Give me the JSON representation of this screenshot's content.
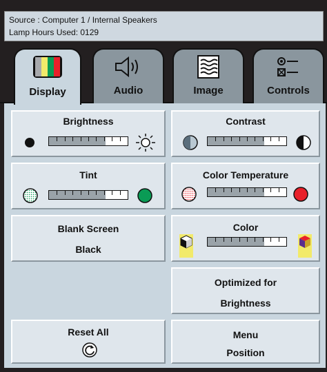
{
  "status": {
    "source_line": "Source : Computer 1 / Internal Speakers",
    "lamp_line": "Lamp Hours Used: 0129"
  },
  "tabs": [
    {
      "label": "Display",
      "icon": "display-color-bars-icon",
      "active": true
    },
    {
      "label": "Audio",
      "icon": "speaker-icon",
      "active": false
    },
    {
      "label": "Image",
      "icon": "image-waves-icon",
      "active": false
    },
    {
      "label": "Controls",
      "icon": "controls-toggle-icon",
      "active": false
    }
  ],
  "controls": {
    "brightness": {
      "label": "Brightness",
      "level": 0.72
    },
    "contrast": {
      "label": "Contrast",
      "level": 0.72
    },
    "tint": {
      "label": "Tint",
      "level": 0.72
    },
    "color_temperature": {
      "label": "Color Temperature",
      "level": 0.72
    },
    "blank_screen": {
      "label": "Blank Screen",
      "value": "Black"
    },
    "color": {
      "label": "Color",
      "level": 0.72
    },
    "optimized": {
      "label": "Optimized for",
      "value": "Brightness"
    },
    "reset_all": {
      "label": "Reset All"
    },
    "menu_position": {
      "label": "Menu",
      "value": "Position"
    }
  },
  "colors": {
    "panel": "#c9d6df",
    "button": "#dfe6ec",
    "inactive_tab": "#8a969e",
    "tint_green": "#0a9b55",
    "temperature_red": "#e8202a",
    "color_yellow": "#f2ea6a"
  }
}
